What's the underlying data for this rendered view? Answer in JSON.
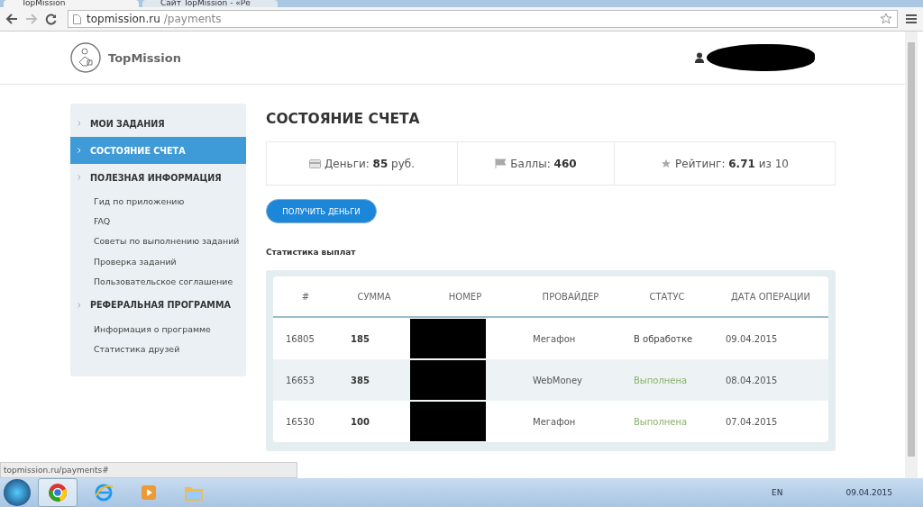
{
  "browser": {
    "tabs": [
      {
        "title": "TopMission",
        "selected": true
      },
      {
        "title": "Сайт TopMission - «Ре",
        "selected": false
      }
    ],
    "address_host": "topmission.ru",
    "address_path": "/payments"
  },
  "header": {
    "logo_text": "TopMission"
  },
  "sidebar": {
    "items": [
      {
        "label": "МОИ ЗАДАНИЯ",
        "kind": "section",
        "selected": false
      },
      {
        "label": "СОСТОЯНИЕ СЧЕТА",
        "kind": "section",
        "selected": true
      },
      {
        "label": "ПОЛЕЗНАЯ ИНФОРМАЦИЯ",
        "kind": "section",
        "selected": false
      },
      {
        "label": "Гид по приложению",
        "kind": "link",
        "selected": false
      },
      {
        "label": "FAQ",
        "kind": "link",
        "selected": false
      },
      {
        "label": "Советы по выполнению заданий",
        "kind": "link",
        "selected": false
      },
      {
        "label": "Проверка заданий",
        "kind": "link",
        "selected": false
      },
      {
        "label": "Пользовательское соглашение",
        "kind": "link",
        "selected": false
      },
      {
        "label": "РЕФЕРАЛЬНАЯ ПРОГРАММА",
        "kind": "section",
        "selected": false
      },
      {
        "label": "Информация о программе",
        "kind": "link",
        "selected": false
      },
      {
        "label": "Статистика друзей",
        "kind": "link",
        "selected": false
      }
    ]
  },
  "page_title": "СОСТОЯНИЕ СЧЕТА",
  "stats": [
    {
      "kind": "money",
      "text": "Деньги: **85** руб."
    },
    {
      "kind": "points",
      "text": "Баллы: **460**"
    },
    {
      "kind": "rating",
      "text": "Рейтинг: **6.71** из 10"
    }
  ],
  "withdraw_button": "ПОЛУЧИТЬ ДЕНЬГИ",
  "payouts": {
    "title": "Статистика выплат",
    "columns": [
      "#",
      "СУММА",
      "НОМЕР",
      "ПРОВАЙДЕР",
      "СТАТУС",
      "ДАТА ОПЕРАЦИИ"
    ],
    "rows": [
      {
        "id": "16805",
        "amount": "185",
        "provider": "Мегафон",
        "status": "В обработке",
        "completed": false,
        "date": "09.04.2015"
      },
      {
        "id": "16653",
        "amount": "385",
        "provider": "WebMoney",
        "status": "Выполнена",
        "completed": true,
        "date": "08.04.2015"
      },
      {
        "id": "16530",
        "amount": "100",
        "provider": "Мегафон",
        "status": "Выполнена",
        "completed": true,
        "date": "07.04.2015"
      }
    ]
  },
  "status_url": "topmission.ru/payments#",
  "taskbar": {
    "language": "EN",
    "date": "09.04.2015"
  }
}
